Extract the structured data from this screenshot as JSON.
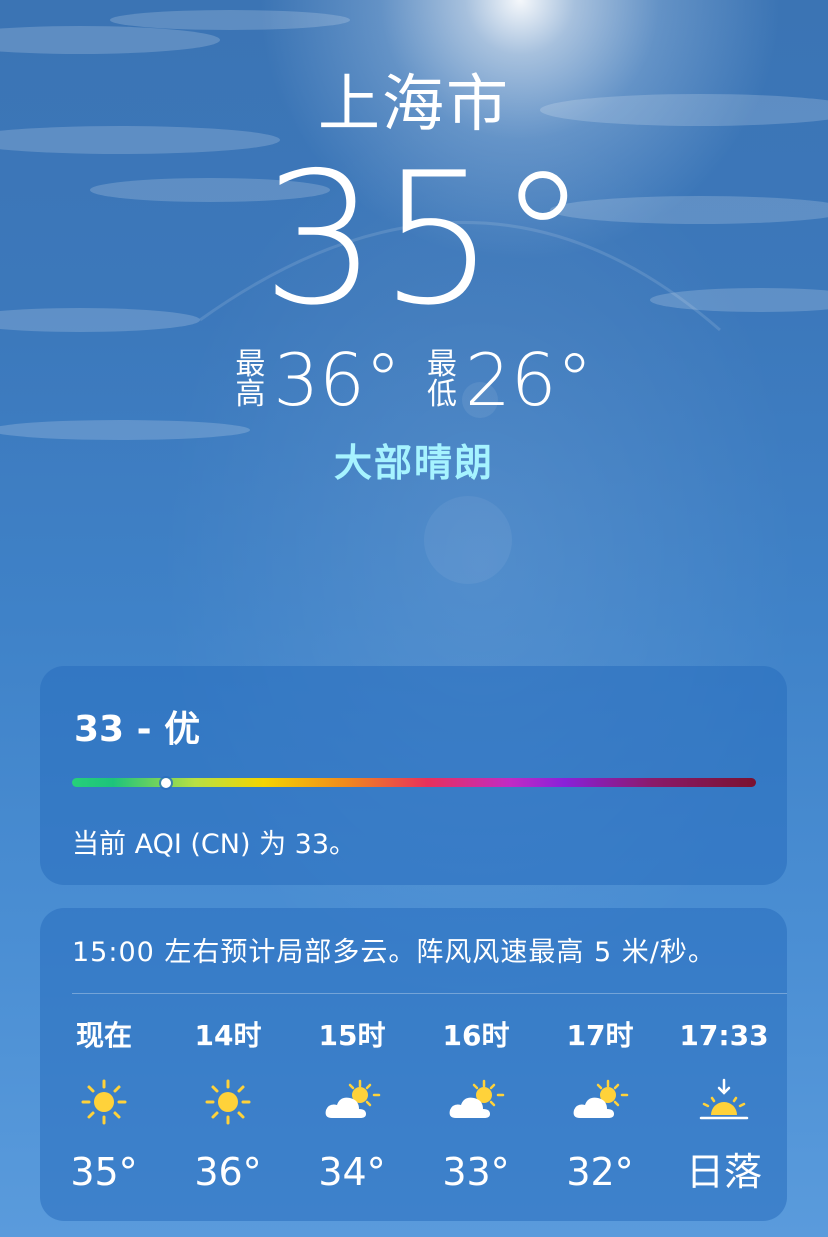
{
  "location": {
    "city": "上海市"
  },
  "current": {
    "temperature": "35°",
    "high_label": [
      "最",
      "高"
    ],
    "high": "36°",
    "low_label": [
      "最",
      "低"
    ],
    "low": "26°",
    "condition": "大部晴朗"
  },
  "aqi": {
    "title": "33 - 优",
    "value": 33,
    "description": "当前 AQI (CN) 为 33。"
  },
  "forecast": {
    "summary": "15:00 左右预计局部多云。阵风风速最高 5 米/秒。",
    "hours": [
      {
        "label": "现在",
        "icon": "sun-icon",
        "temp": "35°"
      },
      {
        "label": "14时",
        "icon": "sun-icon",
        "temp": "36°"
      },
      {
        "label": "15时",
        "icon": "partly-cloudy-icon",
        "temp": "34°"
      },
      {
        "label": "16时",
        "icon": "partly-cloudy-icon",
        "temp": "33°"
      },
      {
        "label": "17时",
        "icon": "partly-cloudy-icon",
        "temp": "32°"
      },
      {
        "label": "17:33",
        "icon": "sunset-icon",
        "temp": "日落"
      }
    ]
  },
  "colors": {
    "condition": "#a6f3ff",
    "sun": "#ffd23a"
  }
}
